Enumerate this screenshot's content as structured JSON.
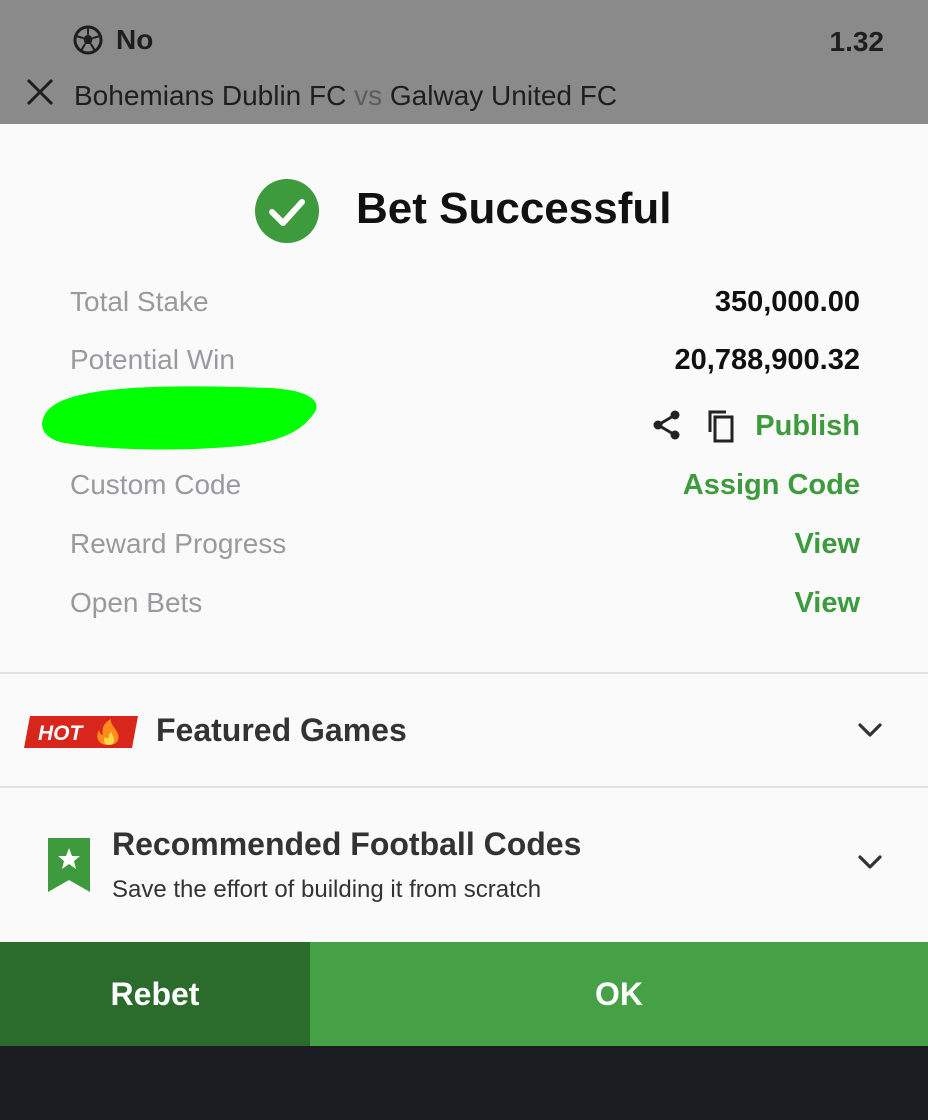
{
  "background_slip": {
    "selection": "No",
    "odds": "1.32",
    "home_team": "Bohemians Dublin FC",
    "vs": "vs",
    "away_team": "Galway United FC"
  },
  "success": {
    "title": "Bet Successful"
  },
  "details": {
    "total_stake_label": "Total Stake",
    "total_stake_value": "350,000.00",
    "potential_win_label": "Potential Win",
    "potential_win_value": "20,788,900.32",
    "publish_label": "Publish",
    "custom_code_label": "Custom Code",
    "custom_code_action": "Assign Code",
    "reward_progress_label": "Reward Progress",
    "reward_progress_action": "View",
    "open_bets_label": "Open Bets",
    "open_bets_action": "View"
  },
  "featured": {
    "badge": "HOT",
    "title": "Featured Games"
  },
  "recommended": {
    "title": "Recommended Football Codes",
    "subtitle": "Save the effort of building it from scratch"
  },
  "buttons": {
    "rebet": "Rebet",
    "ok": "OK"
  },
  "colors": {
    "accent_green": "#3d9a3d",
    "ok_green": "#46a046",
    "rebet_green": "#2b6b2b",
    "hot_red": "#d9261c",
    "redaction_green": "#00ff00"
  },
  "icons": {
    "ball": "football-icon",
    "close": "close-icon",
    "check": "check-circle-icon",
    "share": "share-icon",
    "copy": "copy-icon",
    "fire": "fire-icon",
    "chevron": "chevron-down-icon",
    "bookmark": "bookmark-star-icon"
  }
}
